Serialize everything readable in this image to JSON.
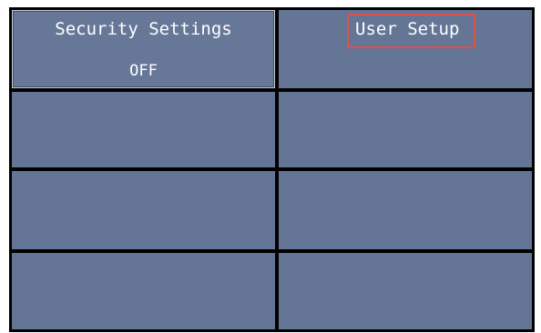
{
  "panel": {
    "security_settings": {
      "title": "Security Settings",
      "value": "OFF"
    },
    "user_setup": {
      "title": "User Setup"
    }
  },
  "colors": {
    "cell_background": "#657596",
    "grid_lines": "#000000",
    "text": "#ffffff",
    "highlight": "#e0504a"
  }
}
